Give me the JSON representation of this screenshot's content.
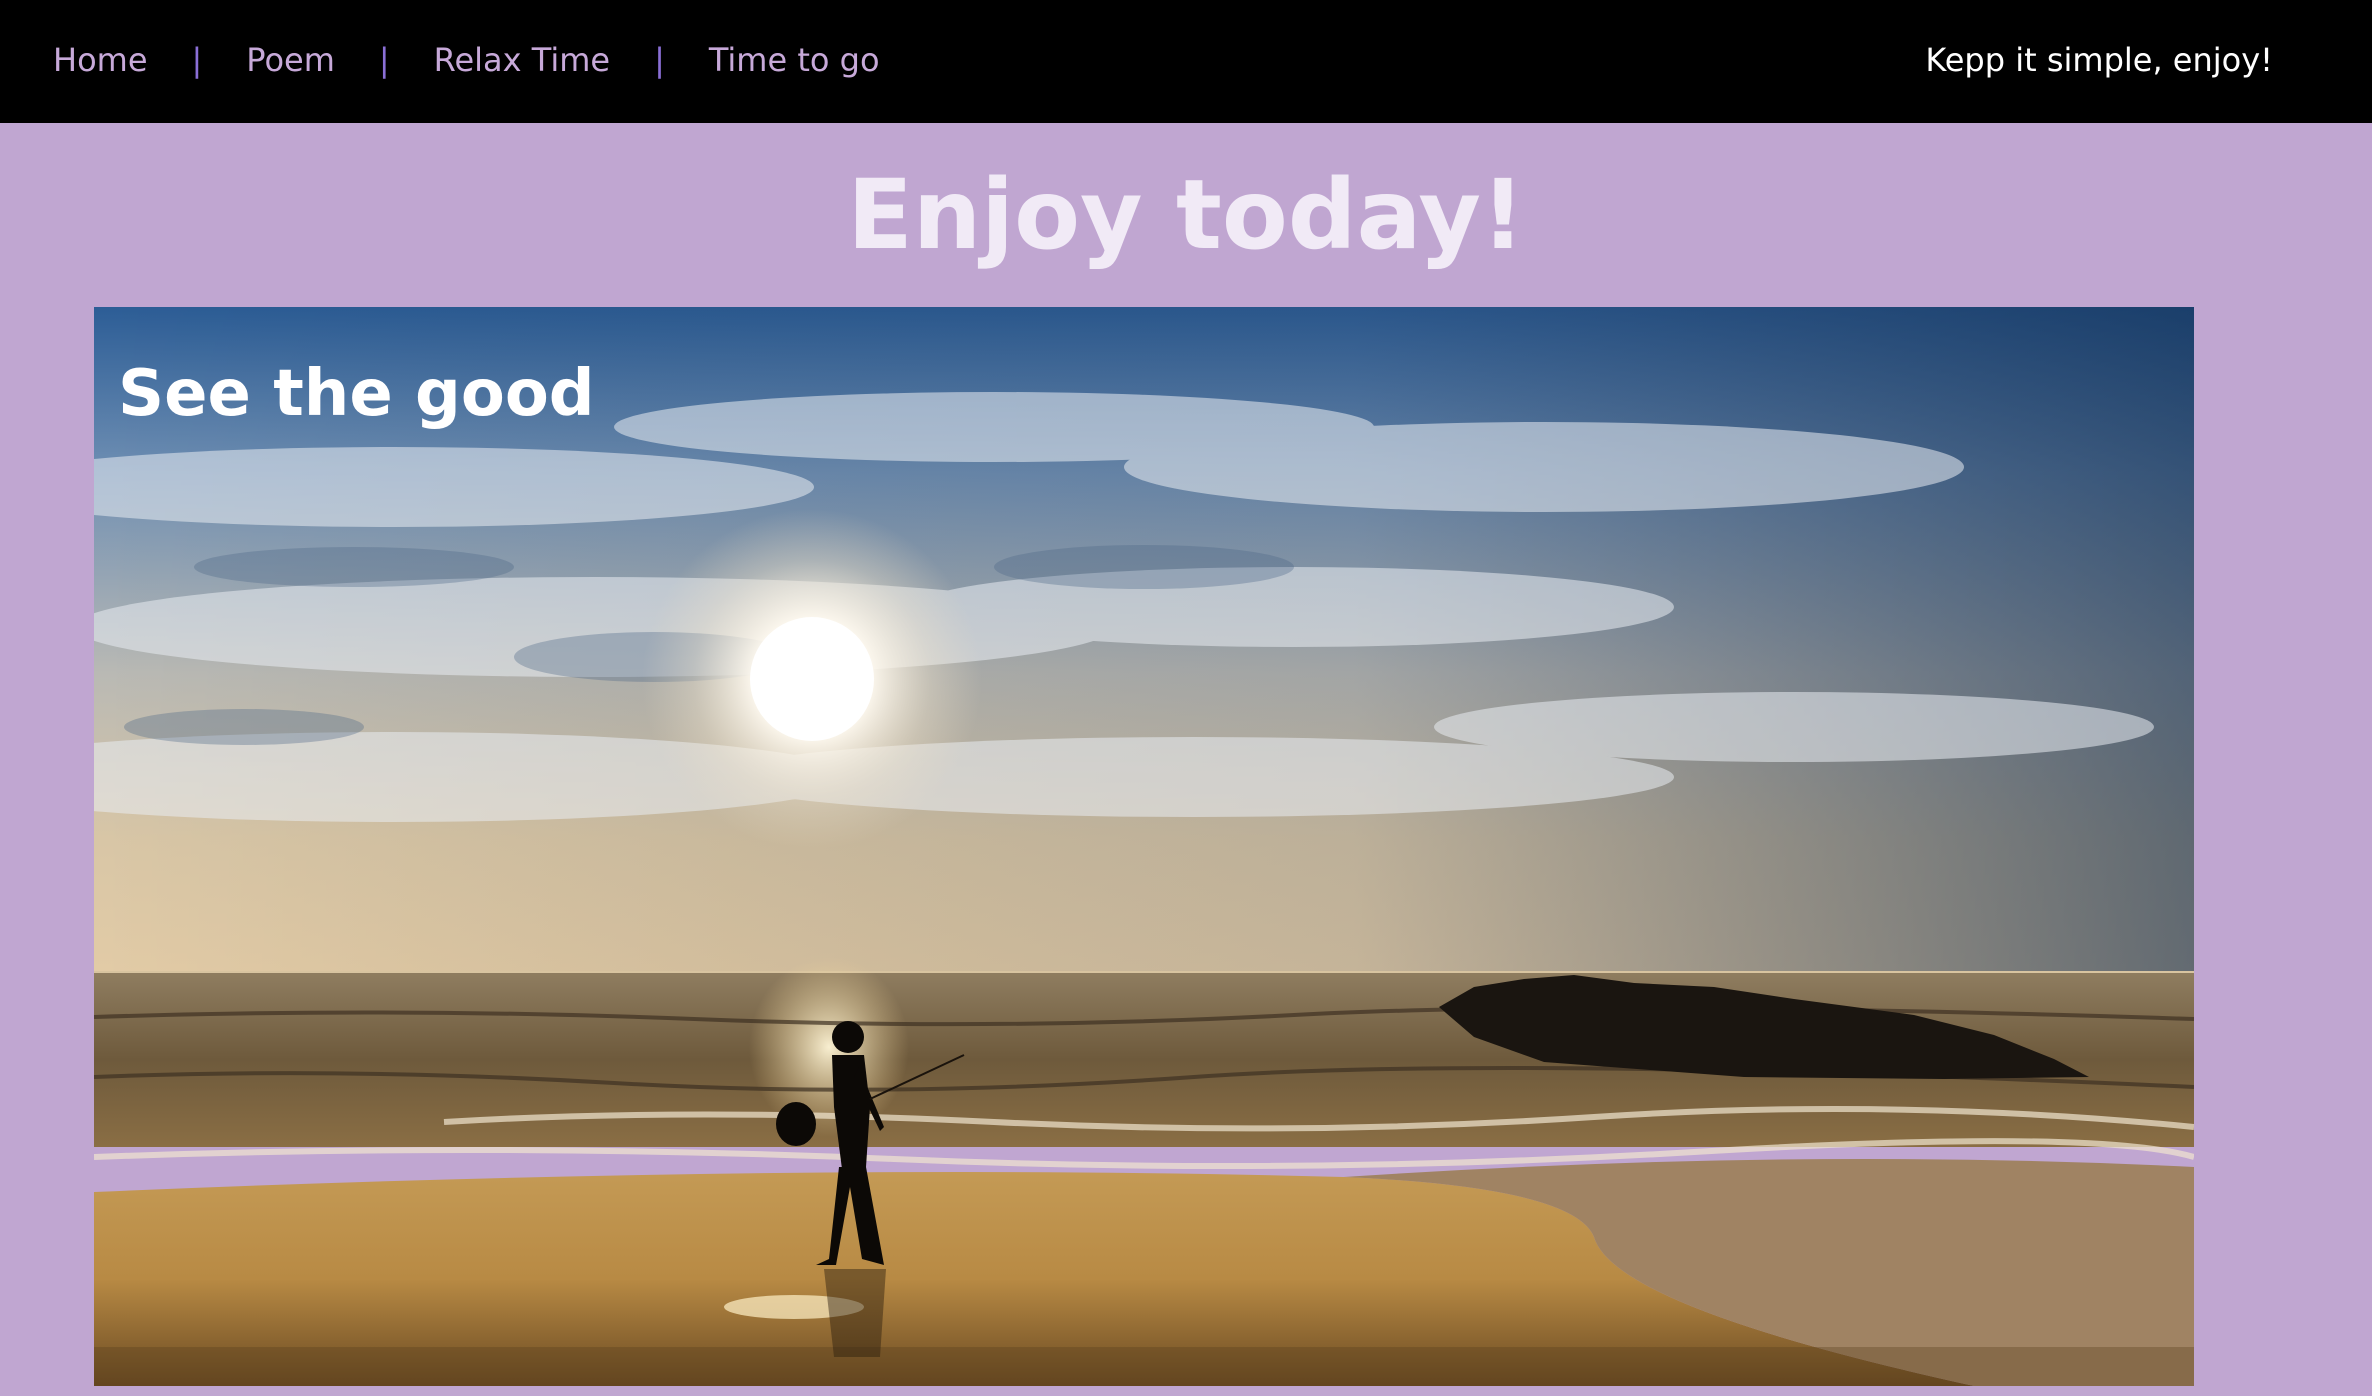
{
  "nav": {
    "items": [
      {
        "label": "Home"
      },
      {
        "label": "Poem"
      },
      {
        "label": "Relax Time"
      },
      {
        "label": "Time to go"
      }
    ],
    "separator": "|",
    "tagline": "Kepp it simple, enjoy!"
  },
  "main": {
    "title": "Enjoy today!",
    "hero": {
      "caption": "See the good"
    }
  },
  "colors": {
    "page_background": "#c0a6d1",
    "nav_background": "#000000",
    "nav_link": "#c7a9d9",
    "nav_separator": "#8a6fd6",
    "title": "#f1eaf6"
  }
}
